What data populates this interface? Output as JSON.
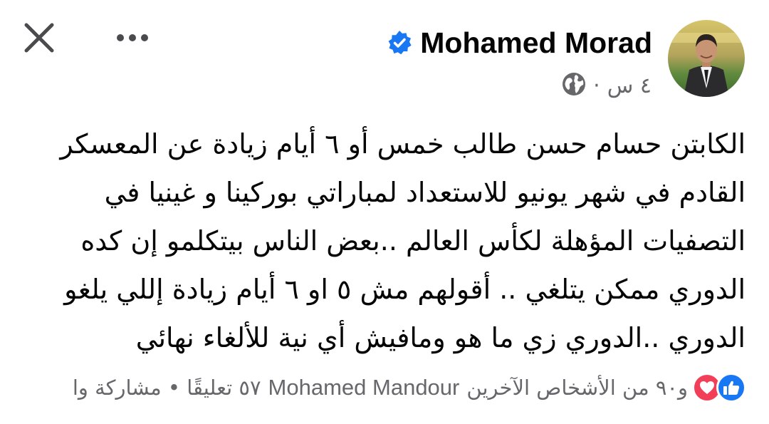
{
  "header": {
    "author_name": "Mohamed Morad",
    "time": "٤ س",
    "separator": "·",
    "close_icon": "close-icon",
    "more_icon": "more-options-icon",
    "verified_icon": "verified-badge-icon",
    "privacy_icon": "globe-icon"
  },
  "post": {
    "lines": [
      "الكابتن حسام حسن طالب خمس أو ٦ أيام زيادة عن المعسكر",
      "القادم في شهر يونيو للاستعداد لمباراتي بوركينا و غينيا في",
      "التصفيات المؤهلة لكأس العالم ..بعض الناس بيتكلمو إن كده",
      "الدوري ممكن يتلغي .. أقولهم مش ٥ او ٦ أيام زيادة إللي يلغو",
      "الدوري ..الدوري زي ما هو ومافيش أي نية للألغاء نهائي"
    ]
  },
  "footer": {
    "reactions_summary": "و٩٠ من الأشخاص الآخرين",
    "reactor_name": "Mohamed Mandour",
    "comments": "٥٧ تعليقًا • مشاركة وا",
    "reaction_icons": [
      "like-icon",
      "love-icon"
    ]
  },
  "colors": {
    "text": "#050505",
    "secondary": "#65676b",
    "like_blue": "#1877f2",
    "love_red": "#f33e58"
  }
}
